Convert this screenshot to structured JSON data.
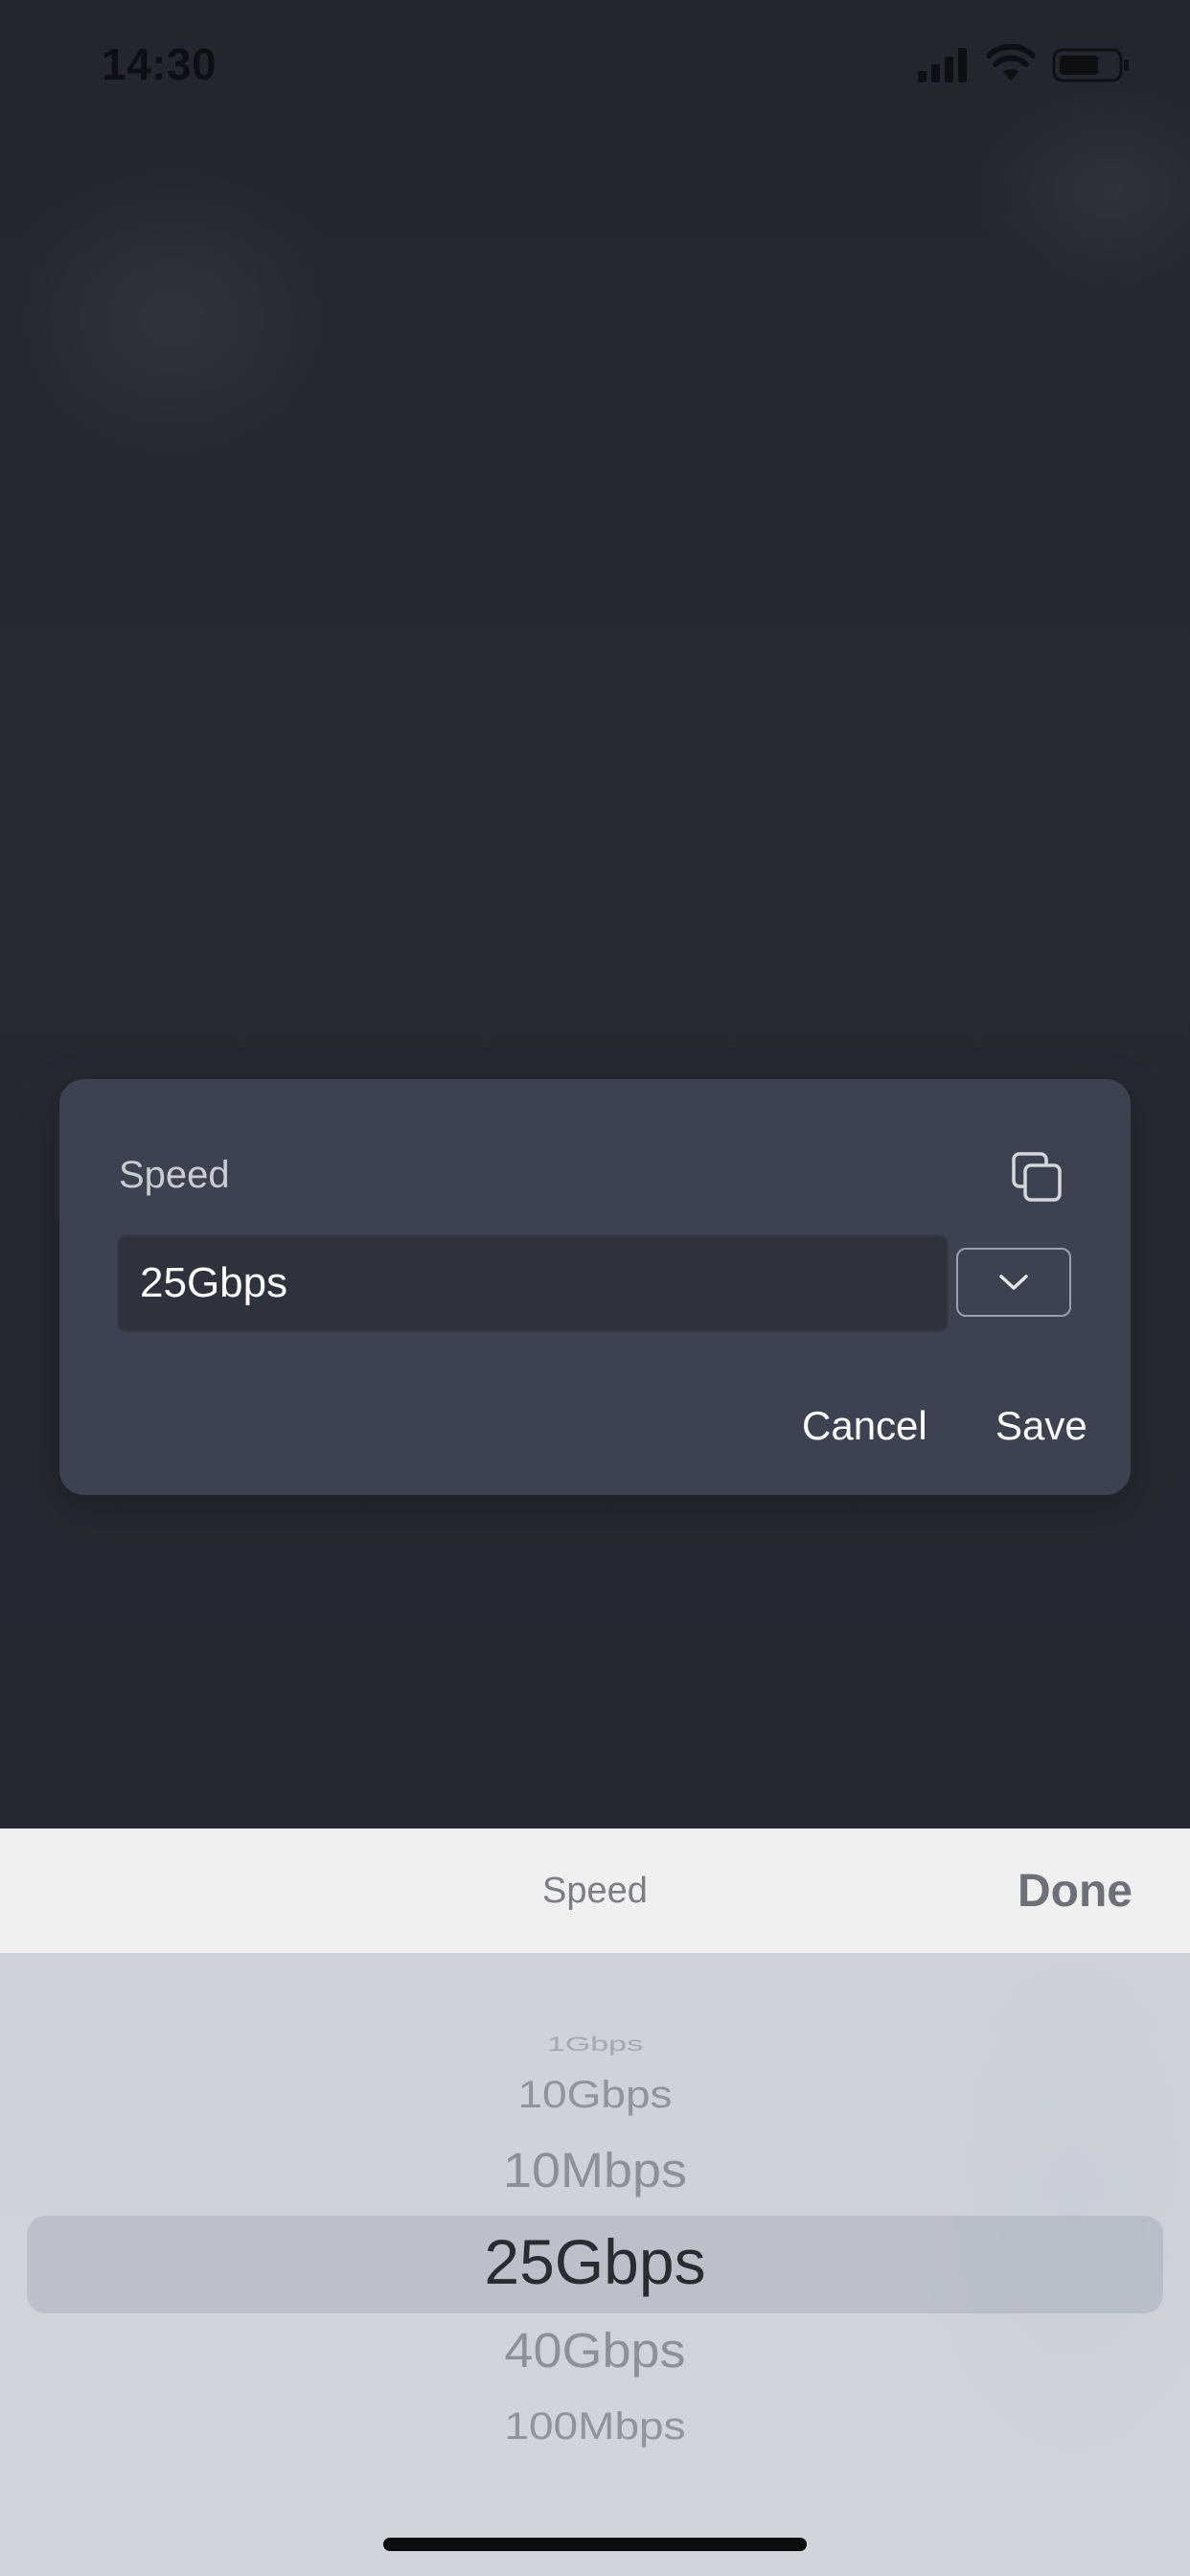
{
  "status_bar": {
    "time": "14:30"
  },
  "dialog": {
    "title": "Speed",
    "input_value": "25Gbps",
    "cancel_label": "Cancel",
    "save_label": "Save"
  },
  "picker": {
    "title": "Speed",
    "done_label": "Done",
    "options": [
      "1Gbps",
      "10Gbps",
      "10Mbps",
      "25Gbps",
      "40Gbps",
      "100Mbps"
    ],
    "selected": "25Gbps"
  },
  "colors": {
    "backdrop": "#252932",
    "card": "#3c4250",
    "input_bg": "#2d323c",
    "picker_bg": "#cfd3da",
    "toolbar_bg": "#f0f0f1"
  },
  "icons": {
    "copy": "copy-icon",
    "dropdown": "chevron-down-icon",
    "signal": "signal-icon",
    "wifi": "wifi-icon",
    "battery": "battery-icon"
  }
}
